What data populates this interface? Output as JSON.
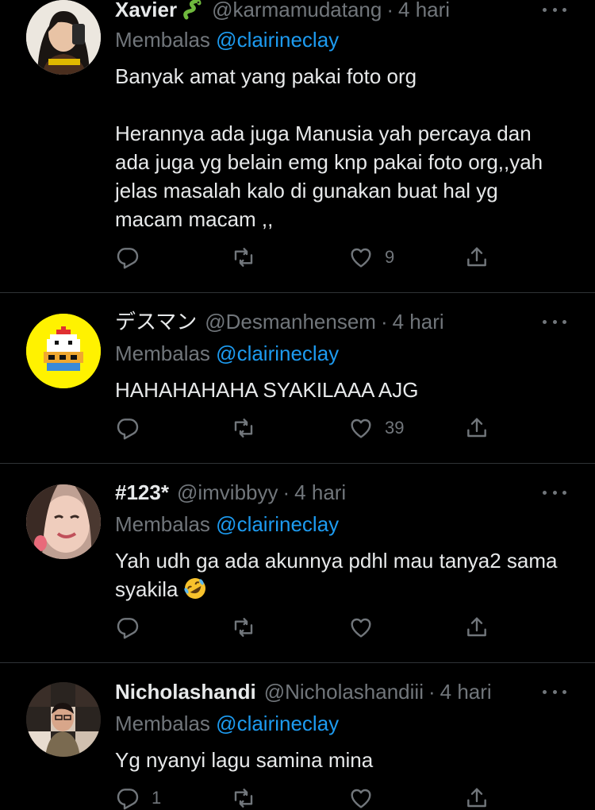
{
  "timeline": {
    "replies": [
      {
        "name": "Xavier",
        "name_emoji": "snake-emoji",
        "handle": "@karmamudatang",
        "time": "4 hari",
        "reply_prefix": "Membalas",
        "reply_to": "@clairineclay",
        "body": "Banyak amat yang pakai foto org\n\nHerannya ada juga Manusia yah percaya dan ada juga yg belain emg knp pakai foto org,,yah jelas masalah kalo di gunakan buat hal yg macam macam ,,",
        "reply_count": "",
        "retweet_count": "",
        "like_count": "9"
      },
      {
        "name": "デスマン",
        "handle": "@Desmanhensem",
        "time": "4 hari",
        "reply_prefix": "Membalas",
        "reply_to": "@clairineclay",
        "body": "HAHAHAHAHA SYAKILAAA AJG",
        "reply_count": "",
        "retweet_count": "",
        "like_count": "39"
      },
      {
        "name": "#123*",
        "handle": "@imvibbyy",
        "time": "4 hari",
        "reply_prefix": "Membalas",
        "reply_to": "@clairineclay",
        "body": "Yah udh ga ada akunnya pdhl mau tanya2 sama syakila",
        "body_emoji": "rolling-on-floor-laughing-emoji",
        "reply_count": "",
        "retweet_count": "",
        "like_count": ""
      },
      {
        "name": "Nicholashandi",
        "handle": "@Nicholashandiii",
        "time": "4 hari",
        "reply_prefix": "Membalas",
        "reply_to": "@clairineclay",
        "body": "Yg nyanyi lagu samina mina",
        "reply_count": "1",
        "retweet_count": "",
        "like_count": ""
      }
    ],
    "separator": "·"
  },
  "colors": {
    "background": "#000000",
    "text": "#e7e9ea",
    "muted": "#71767b",
    "accent": "#1d9bf0",
    "divider": "#2f3336",
    "avatar2_bg": "#fff200"
  },
  "icons": [
    "reply-icon",
    "retweet-icon",
    "like-icon",
    "share-icon",
    "more-icon"
  ]
}
